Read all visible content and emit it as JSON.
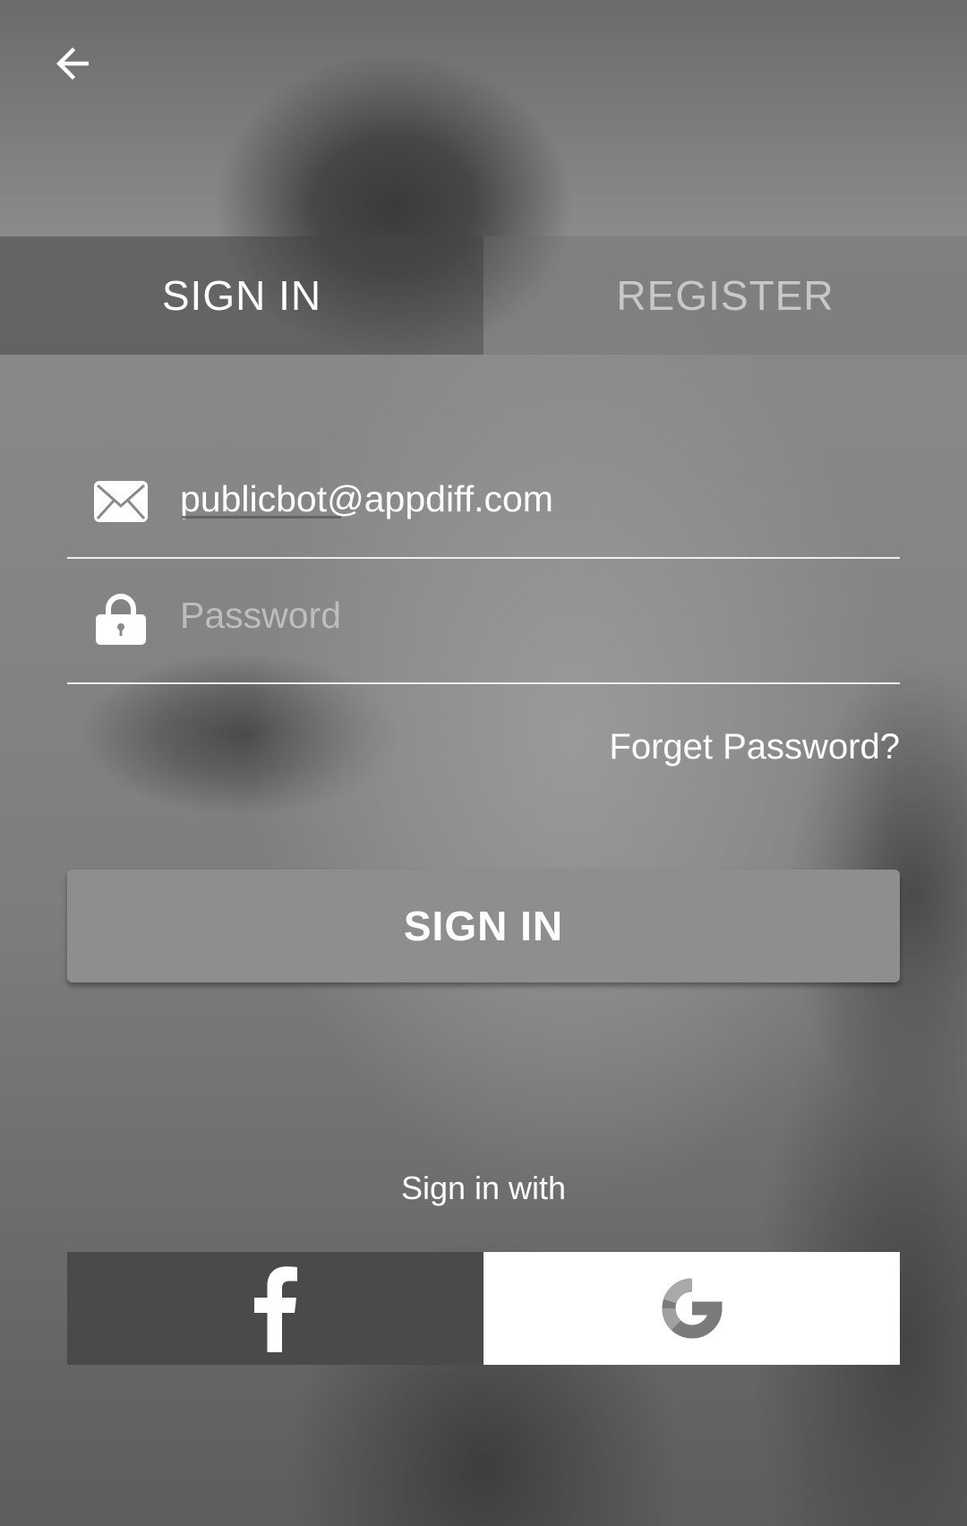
{
  "header": {
    "back_icon": "arrow-left-icon"
  },
  "tabs": [
    {
      "label": "SIGN IN",
      "active": true
    },
    {
      "label": "REGISTER",
      "active": false
    }
  ],
  "form": {
    "email": {
      "icon": "envelope-icon",
      "value": "publicbot@appdiff.com"
    },
    "password": {
      "icon": "lock-icon",
      "placeholder": "Password",
      "value": ""
    },
    "forgot_label": "Forget Password?",
    "submit_label": "SIGN IN"
  },
  "social": {
    "title": "Sign in with",
    "facebook_icon": "facebook-icon",
    "google_icon": "google-icon"
  },
  "colors": {
    "button_bg": "#8e8e8e",
    "facebook_bg": "#4a4a4a",
    "google_bg": "#ffffff",
    "inactive_tab_text": "#c8c8c8"
  }
}
